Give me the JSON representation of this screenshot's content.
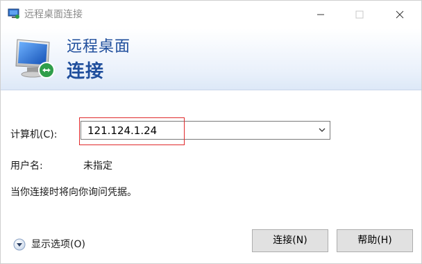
{
  "window": {
    "title": "远程桌面连接"
  },
  "banner": {
    "line1": "远程桌面",
    "line2": "连接"
  },
  "form": {
    "computer_label": "计算机(C):",
    "computer_value": "121.124.1.24",
    "user_label": "用户名:",
    "user_value": "未指定",
    "notice": "当你连接时将向你询问凭据。"
  },
  "footer": {
    "options_label": "显示选项(O)",
    "connect_label": "连接(N)",
    "help_label": "帮助(H)"
  },
  "colors": {
    "banner_text": "#1f4e9c",
    "highlight": "#e0292b",
    "button_face": "#e1e1e1"
  },
  "icons": {
    "app": "remote-desktop-icon",
    "banner": "monitor-connection-icon",
    "options": "chevron-down-circle-icon",
    "combo": "chevron-down-icon"
  }
}
